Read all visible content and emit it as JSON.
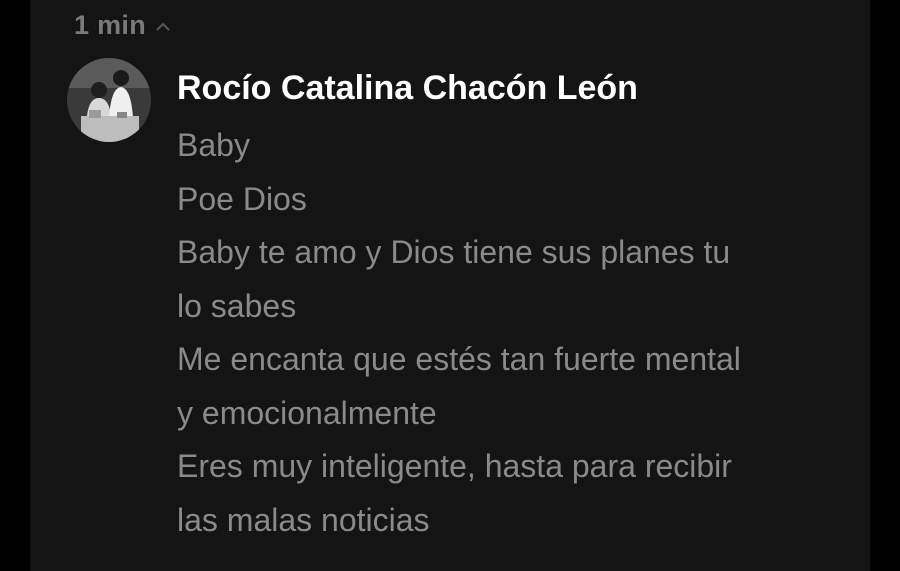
{
  "comment": {
    "time": "1 min",
    "author": "Rocío Catalina Chacón León",
    "avatar_icon": "profile-photo-avatar",
    "lines": [
      "Baby",
      "Poe Dios",
      "Baby te amo y Dios tiene sus planes tu",
      "lo sabes",
      "Me encanta que estés tan fuerte mental",
      "y emocionalmente",
      "Eres muy inteligente, hasta para recibir",
      "las malas noticias"
    ]
  },
  "colors": {
    "background": "#000000",
    "panel": "#141414",
    "author_text": "#ffffff",
    "message_text": "#8a8a8a",
    "time_text": "#7a7a7a"
  }
}
